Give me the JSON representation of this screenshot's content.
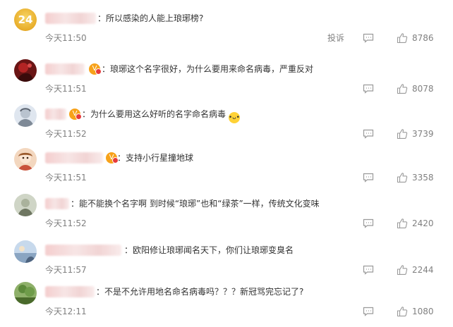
{
  "actions": {
    "report_label": "投诉"
  },
  "comments": [
    {
      "avatar_text": "24",
      "text": "：所以感染的人能上琅琊榜?",
      "time": "今天11:50",
      "likes": "8786"
    },
    {
      "text": "：琅琊这个名字很好，为什么要用来命名病毒，严重反对",
      "time": "今天11:51",
      "likes": "8078"
    },
    {
      "text": "：为什么要用这么好听的名字命名病毒",
      "time": "今天11:52",
      "likes": "3739"
    },
    {
      "text": "：支持小行星撞地球",
      "time": "今天11:51",
      "likes": "3358"
    },
    {
      "text": "：能不能换个名字啊 到时候“琅琊”也和“绿茶”一样，传统文化变味",
      "time": "今天11:52",
      "likes": "2420"
    },
    {
      "text": "：欧阳修让琅琊闻名天下，你们让琅琊变臭名",
      "time": "今天11:57",
      "likes": "2244"
    },
    {
      "text": "：不是不允许用地名命名病毒吗？？？新冠骂完忘记了?",
      "time": "今天12:11",
      "likes": "1080"
    }
  ],
  "colors": {
    "text": "#333333",
    "meta": "#808080",
    "vip": "#f7a21a"
  }
}
